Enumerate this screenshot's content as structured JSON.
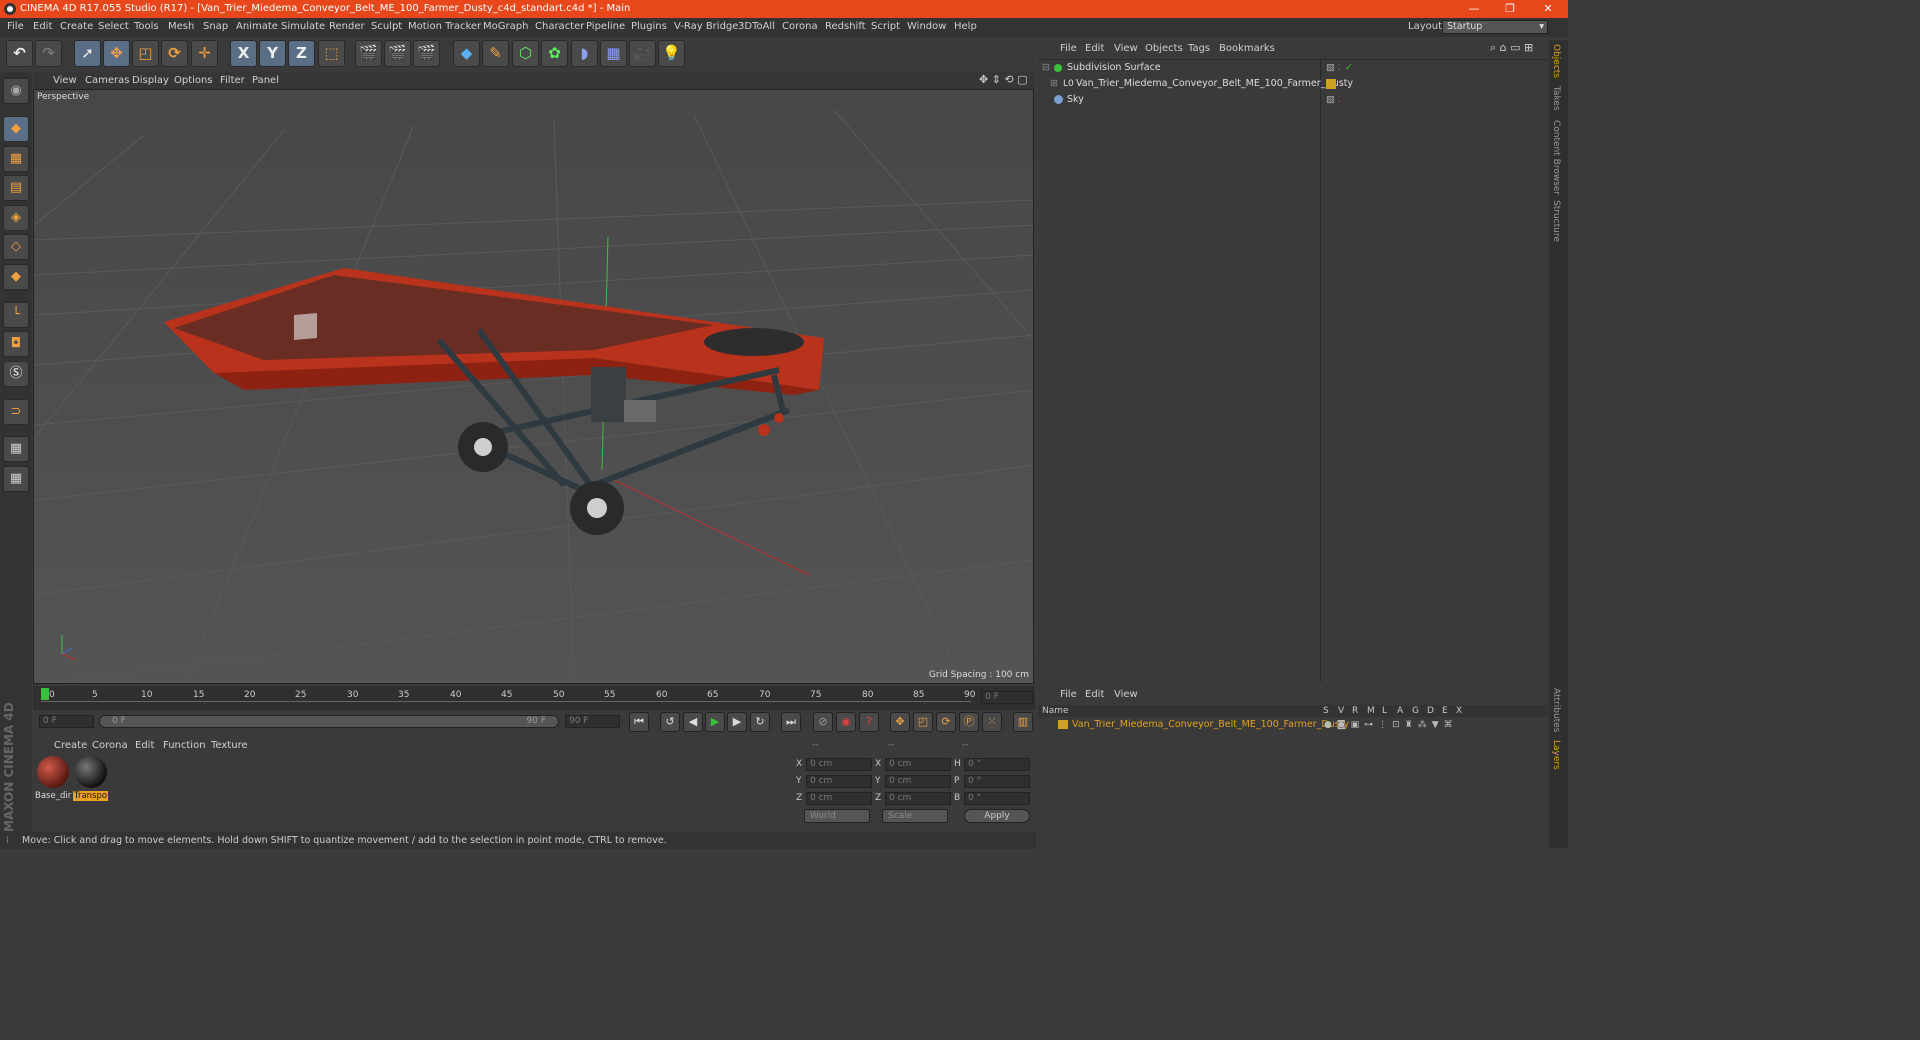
{
  "window": {
    "title": "CINEMA 4D R17.055 Studio (R17) - [Van_Trier_Miedema_Conveyor_Belt_ME_100_Farmer_Dusty_c4d_standart.c4d *] - Main",
    "buttons": [
      "—",
      "❐",
      "✕"
    ]
  },
  "menu": [
    "File",
    "Edit",
    "Create",
    "Select",
    "Tools",
    "Mesh",
    "Snap",
    "Animate",
    "Simulate",
    "Render",
    "Sculpt",
    "Motion Tracker",
    "MoGraph",
    "Character",
    "Pipeline",
    "Plugins",
    "V-Ray Bridge",
    "3DToAll",
    "Corona",
    "Redshift",
    "Script",
    "Window",
    "Help"
  ],
  "layout": {
    "label": "Layout:",
    "value": "Startup"
  },
  "toolbar": {
    "axis_x": "X",
    "axis_y": "Y",
    "axis_z": "Z"
  },
  "viewport": {
    "menu": [
      "View",
      "Cameras",
      "Display",
      "Options",
      "Filter",
      "Panel"
    ],
    "name": "Perspective",
    "grid_spacing": "Grid Spacing : 100 cm"
  },
  "timeline": {
    "ticks": [
      "0",
      "5",
      "10",
      "15",
      "20",
      "25",
      "30",
      "35",
      "40",
      "45",
      "50",
      "55",
      "60",
      "65",
      "70",
      "75",
      "80",
      "85",
      "90"
    ],
    "current": "0 F"
  },
  "transport": {
    "start": "0 F",
    "range_start": "0 F",
    "range_end": "90 F",
    "end": "90 F"
  },
  "materials": {
    "menu": [
      "Create",
      "Corona",
      "Edit",
      "Function",
      "Texture"
    ],
    "items": [
      {
        "name": "Base_dir"
      },
      {
        "name": "Transpo"
      }
    ]
  },
  "coords": {
    "headers": [
      "--",
      "--",
      "--"
    ],
    "rows": [
      {
        "a": "X",
        "av": "0 cm",
        "b": "X",
        "bv": "0 cm",
        "c": "H",
        "cv": "0 °"
      },
      {
        "a": "Y",
        "av": "0 cm",
        "b": "Y",
        "bv": "0 cm",
        "c": "P",
        "cv": "0 °"
      },
      {
        "a": "Z",
        "av": "0 cm",
        "b": "Z",
        "bv": "0 cm",
        "c": "B",
        "cv": "0 °"
      }
    ],
    "world": "World",
    "scale": "Scale",
    "apply": "Apply"
  },
  "objects": {
    "menu": [
      "File",
      "Edit",
      "View",
      "Objects",
      "Tags",
      "Bookmarks"
    ],
    "items": [
      {
        "name": "Subdivision Surface"
      },
      {
        "name": "Van_Trier_Miedema_Conveyor_Belt_ME_100_Farmer_Dusty"
      },
      {
        "name": "Sky"
      }
    ]
  },
  "layers": {
    "menu": [
      "File",
      "Edit",
      "View"
    ],
    "name_header": "Name",
    "cols": [
      "S",
      "V",
      "R",
      "M",
      "L",
      "A",
      "G",
      "D",
      "E",
      "X"
    ],
    "item": "Van_Trier_Miedema_Conveyor_Belt_ME_100_Farmer_Dusty"
  },
  "right_tabs": [
    "Objects",
    "Takes",
    "Content Browser",
    "Structure",
    "Attributes",
    "Layers"
  ],
  "status": "Move: Click and drag to move elements. Hold down SHIFT to quantize movement / add to the selection in point mode, CTRL to remove.",
  "brand": "MAXON CINEMA 4D"
}
